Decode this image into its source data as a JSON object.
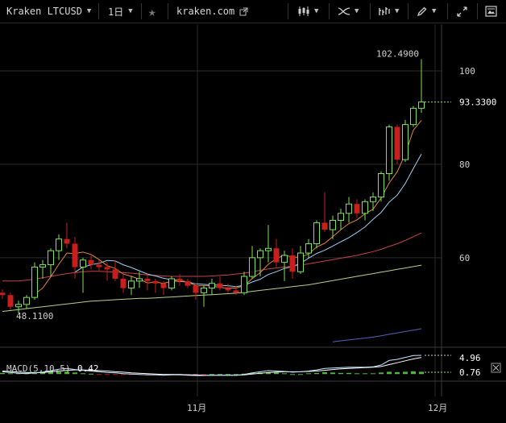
{
  "toolbar": {
    "symbol": "Kraken LTCUSD",
    "interval": "1日",
    "url": "kraken.com"
  },
  "colors": {
    "up": "#7ee25a",
    "down": "#c81e1e",
    "ma5": "#e0883a",
    "ma10": "#9fd0f0",
    "ma20": "#c0454c",
    "ma30": "#b7d18a",
    "ma60": "#5561b8",
    "macd": "#c7e6ff",
    "signal": "#ffffff"
  },
  "chart_data": {
    "type": "candlestick",
    "x_ticks": [
      "11月",
      "12月"
    ],
    "y_ticks": [
      60,
      80,
      100
    ],
    "ylim": [
      41,
      110
    ],
    "price_labels": {
      "high": "102.4900",
      "last": "93.3300",
      "low": "48.1100"
    },
    "candles": [
      [
        52.5,
        53.2,
        51.2,
        52.0
      ],
      [
        52.0,
        52.5,
        48.8,
        49.5
      ],
      [
        49.5,
        50.8,
        48.1,
        50.0
      ],
      [
        50.0,
        52.0,
        49.0,
        51.5
      ],
      [
        51.5,
        59.0,
        51.0,
        58.0
      ],
      [
        58.0,
        59.5,
        55.5,
        58.5
      ],
      [
        58.5,
        62.0,
        56.0,
        61.5
      ],
      [
        61.5,
        65.0,
        59.5,
        64.0
      ],
      [
        64.0,
        67.5,
        62.0,
        63.0
      ],
      [
        63.0,
        64.5,
        55.5,
        58.0
      ],
      [
        58.0,
        60.0,
        52.5,
        59.5
      ],
      [
        59.5,
        60.5,
        57.5,
        58.5
      ],
      [
        58.5,
        59.5,
        57.0,
        58.0
      ],
      [
        58.0,
        59.0,
        55.0,
        57.5
      ],
      [
        57.5,
        59.5,
        55.0,
        55.5
      ],
      [
        55.5,
        57.0,
        52.5,
        53.5
      ],
      [
        53.5,
        56.0,
        52.0,
        55.0
      ],
      [
        55.0,
        57.0,
        53.5,
        55.5
      ],
      [
        55.5,
        56.5,
        53.0,
        55.0
      ],
      [
        55.0,
        55.5,
        52.5,
        54.5
      ],
      [
        54.5,
        55.0,
        52.0,
        53.5
      ],
      [
        53.5,
        56.0,
        53.0,
        55.5
      ],
      [
        55.5,
        56.5,
        54.0,
        55.0
      ],
      [
        55.0,
        55.5,
        53.5,
        54.0
      ],
      [
        54.0,
        54.5,
        51.0,
        52.5
      ],
      [
        52.5,
        54.0,
        49.5,
        53.5
      ],
      [
        53.5,
        55.5,
        52.0,
        54.5
      ],
      [
        54.5,
        56.0,
        53.0,
        53.5
      ],
      [
        53.5,
        54.5,
        52.5,
        53.0
      ],
      [
        53.0,
        54.0,
        52.0,
        52.5
      ],
      [
        52.5,
        57.0,
        52.0,
        56.0
      ],
      [
        56.0,
        62.5,
        55.5,
        60.0
      ],
      [
        60.0,
        62.0,
        56.0,
        61.5
      ],
      [
        61.5,
        67.0,
        59.0,
        62.0
      ],
      [
        62.0,
        64.0,
        58.0,
        59.0
      ],
      [
        59.0,
        61.5,
        55.0,
        60.5
      ],
      [
        60.5,
        62.0,
        55.5,
        57.0
      ],
      [
        57.0,
        62.5,
        56.5,
        61.0
      ],
      [
        61.0,
        64.0,
        60.0,
        63.0
      ],
      [
        63.0,
        68.0,
        62.0,
        67.5
      ],
      [
        67.5,
        74.0,
        65.5,
        66.0
      ],
      [
        66.0,
        69.0,
        64.0,
        68.0
      ],
      [
        68.0,
        70.5,
        66.0,
        69.5
      ],
      [
        69.5,
        73.0,
        67.5,
        71.5
      ],
      [
        71.5,
        72.5,
        68.5,
        69.5
      ],
      [
        69.5,
        72.5,
        68.0,
        72.0
      ],
      [
        72.0,
        74.0,
        70.0,
        73.0
      ],
      [
        73.0,
        78.5,
        72.0,
        78.0
      ],
      [
        78.0,
        88.5,
        76.5,
        88.0
      ],
      [
        88.0,
        88.5,
        80.0,
        81.0
      ],
      [
        81.0,
        89.5,
        80.5,
        88.5
      ],
      [
        88.5,
        92.5,
        88.0,
        92.0
      ],
      [
        92.0,
        102.49,
        91.0,
        93.33
      ]
    ],
    "ma": {
      "ma5": [
        null,
        null,
        null,
        null,
        52.2,
        53.5,
        55.9,
        58.6,
        61.0,
        60.9,
        61.2,
        60.7,
        59.6,
        58.3,
        57.7,
        56.5,
        56.0,
        55.4,
        54.6,
        54.8,
        54.5,
        55.0,
        54.9,
        54.8,
        54.0,
        54.0,
        54.0,
        53.6,
        53.5,
        53.5,
        54.0,
        55.5,
        56.8,
        58.6,
        59.8,
        60.6,
        60.1,
        60.1,
        60.8,
        62.3,
        63.1,
        64.5,
        66.0,
        67.3,
        68.1,
        69.4,
        70.4,
        72.8,
        76.0,
        78.4,
        82.2,
        87.3,
        89.4
      ],
      "ma10": [
        null,
        null,
        null,
        null,
        null,
        null,
        null,
        null,
        null,
        56.9,
        58.0,
        58.5,
        58.8,
        59.4,
        59.3,
        58.5,
        57.9,
        57.2,
        56.5,
        56.1,
        55.6,
        55.3,
        55.1,
        54.8,
        54.4,
        54.3,
        54.2,
        54.1,
        54.0,
        53.8,
        54.1,
        54.8,
        55.4,
        56.4,
        57.0,
        57.7,
        58.1,
        58.8,
        59.9,
        60.9,
        61.6,
        62.5,
        63.4,
        64.3,
        65.4,
        66.6,
        68.2,
        69.7,
        71.9,
        73.4,
        75.9,
        79.1,
        82.2
      ],
      "ma20": [
        55.0,
        55.0,
        55.0,
        55.2,
        55.4,
        55.7,
        56.0,
        56.3,
        56.6,
        56.8,
        57.0,
        57.1,
        57.1,
        57.0,
        56.9,
        56.8,
        56.7,
        56.5,
        56.3,
        56.2,
        56.1,
        56.0,
        56.0,
        56.0,
        56.0,
        56.0,
        56.1,
        56.2,
        56.3,
        56.5,
        56.7,
        57.0,
        57.3,
        57.6,
        57.8,
        58.0,
        58.2,
        58.4,
        58.7,
        59.0,
        59.3,
        59.6,
        59.9,
        60.2,
        60.5,
        60.9,
        61.3,
        61.8,
        62.4,
        63.0,
        63.7,
        64.5,
        65.3
      ],
      "ma30": [
        48.5,
        48.7,
        48.9,
        49.1,
        49.3,
        49.5,
        49.7,
        49.9,
        50.1,
        50.3,
        50.5,
        50.7,
        50.8,
        50.9,
        51.0,
        51.1,
        51.2,
        51.3,
        51.3,
        51.4,
        51.5,
        51.6,
        51.7,
        51.8,
        51.9,
        52.0,
        52.1,
        52.2,
        52.3,
        52.4,
        52.6,
        52.8,
        53.0,
        53.2,
        53.4,
        53.6,
        53.8,
        54.0,
        54.2,
        54.5,
        54.8,
        55.1,
        55.4,
        55.7,
        56.0,
        56.3,
        56.6,
        56.9,
        57.2,
        57.5,
        57.8,
        58.1,
        58.4
      ],
      "ma60": [
        null,
        null,
        null,
        null,
        null,
        null,
        null,
        null,
        null,
        null,
        null,
        null,
        null,
        null,
        null,
        null,
        null,
        null,
        null,
        null,
        null,
        null,
        null,
        null,
        null,
        null,
        null,
        null,
        null,
        null,
        null,
        null,
        null,
        null,
        null,
        null,
        null,
        null,
        null,
        null,
        null,
        42.0,
        42.2,
        42.4,
        42.6,
        42.8,
        43.0,
        43.3,
        43.6,
        43.9,
        44.2,
        44.5,
        44.8
      ]
    },
    "macd": {
      "label": "MACD(5,10,5)",
      "value": "0.42",
      "ylim": [
        -0.8,
        5.6
      ],
      "y_ticks": [
        "4.96",
        "0.76"
      ],
      "macd_line": [
        0.6,
        0.4,
        0.2,
        0.1,
        0.3,
        0.5,
        0.9,
        1.3,
        1.5,
        1.2,
        1.0,
        0.8,
        0.6,
        0.4,
        0.3,
        0.1,
        0.0,
        -0.1,
        -0.2,
        -0.2,
        -0.3,
        -0.2,
        -0.2,
        -0.3,
        -0.4,
        -0.4,
        -0.3,
        -0.3,
        -0.3,
        -0.3,
        -0.1,
        0.3,
        0.6,
        0.9,
        0.8,
        0.7,
        0.5,
        0.6,
        0.8,
        1.1,
        1.5,
        1.6,
        1.7,
        1.8,
        1.8,
        1.8,
        1.9,
        2.4,
        3.6,
        3.9,
        4.4,
        4.9,
        4.96
      ],
      "signal_line": [
        0.8,
        0.7,
        0.5,
        0.4,
        0.4,
        0.4,
        0.6,
        0.8,
        1.0,
        1.1,
        1.1,
        1.0,
        0.9,
        0.8,
        0.6,
        0.5,
        0.3,
        0.2,
        0.1,
        0.0,
        -0.1,
        -0.1,
        -0.1,
        -0.2,
        -0.2,
        -0.3,
        -0.3,
        -0.3,
        -0.3,
        -0.3,
        -0.2,
        0.0,
        0.2,
        0.4,
        0.5,
        0.6,
        0.6,
        0.6,
        0.7,
        0.8,
        1.0,
        1.2,
        1.4,
        1.5,
        1.6,
        1.7,
        1.8,
        2.0,
        2.5,
        3.0,
        3.5,
        4.0,
        4.4
      ],
      "hist": [
        0.3,
        0.2,
        0.2,
        0.3,
        0.4,
        0.5,
        0.6,
        0.6,
        0.6,
        0.4,
        0.2,
        0.1,
        -0.1,
        -0.2,
        -0.2,
        -0.2,
        -0.2,
        -0.2,
        -0.2,
        -0.2,
        -0.2,
        -0.1,
        -0.1,
        -0.1,
        -0.2,
        -0.1,
        0.0,
        0.0,
        0.0,
        0.0,
        0.1,
        0.3,
        0.4,
        0.5,
        0.4,
        0.2,
        0.0,
        0.0,
        0.2,
        0.3,
        0.5,
        0.4,
        0.3,
        0.3,
        0.2,
        0.2,
        0.2,
        0.4,
        0.6,
        0.5,
        0.6,
        0.7,
        0.6
      ]
    }
  }
}
